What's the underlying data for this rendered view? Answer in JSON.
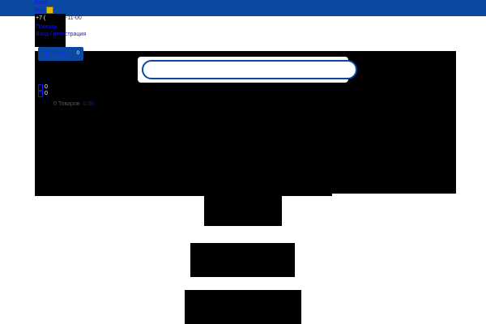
{
  "header": {
    "blog_link": "Блог",
    "rss_link": "Rss",
    "phone_prefix": "+7 (",
    "phone_suffix": "-11-00",
    "help_link": "Помощь",
    "login_link": "Вход / регистрация"
  },
  "catalog_button": {
    "label": "Каталог",
    "count": "0"
  },
  "compare": {
    "count_a": "0",
    "count_b": "0"
  },
  "cart": {
    "items_label": "0 Товаров",
    "total": "0.00"
  },
  "search": {
    "placeholder": ""
  },
  "colors": {
    "topbar": "#0a48a2",
    "link": "#1414e6",
    "accent_yellow": "#e6b800"
  }
}
